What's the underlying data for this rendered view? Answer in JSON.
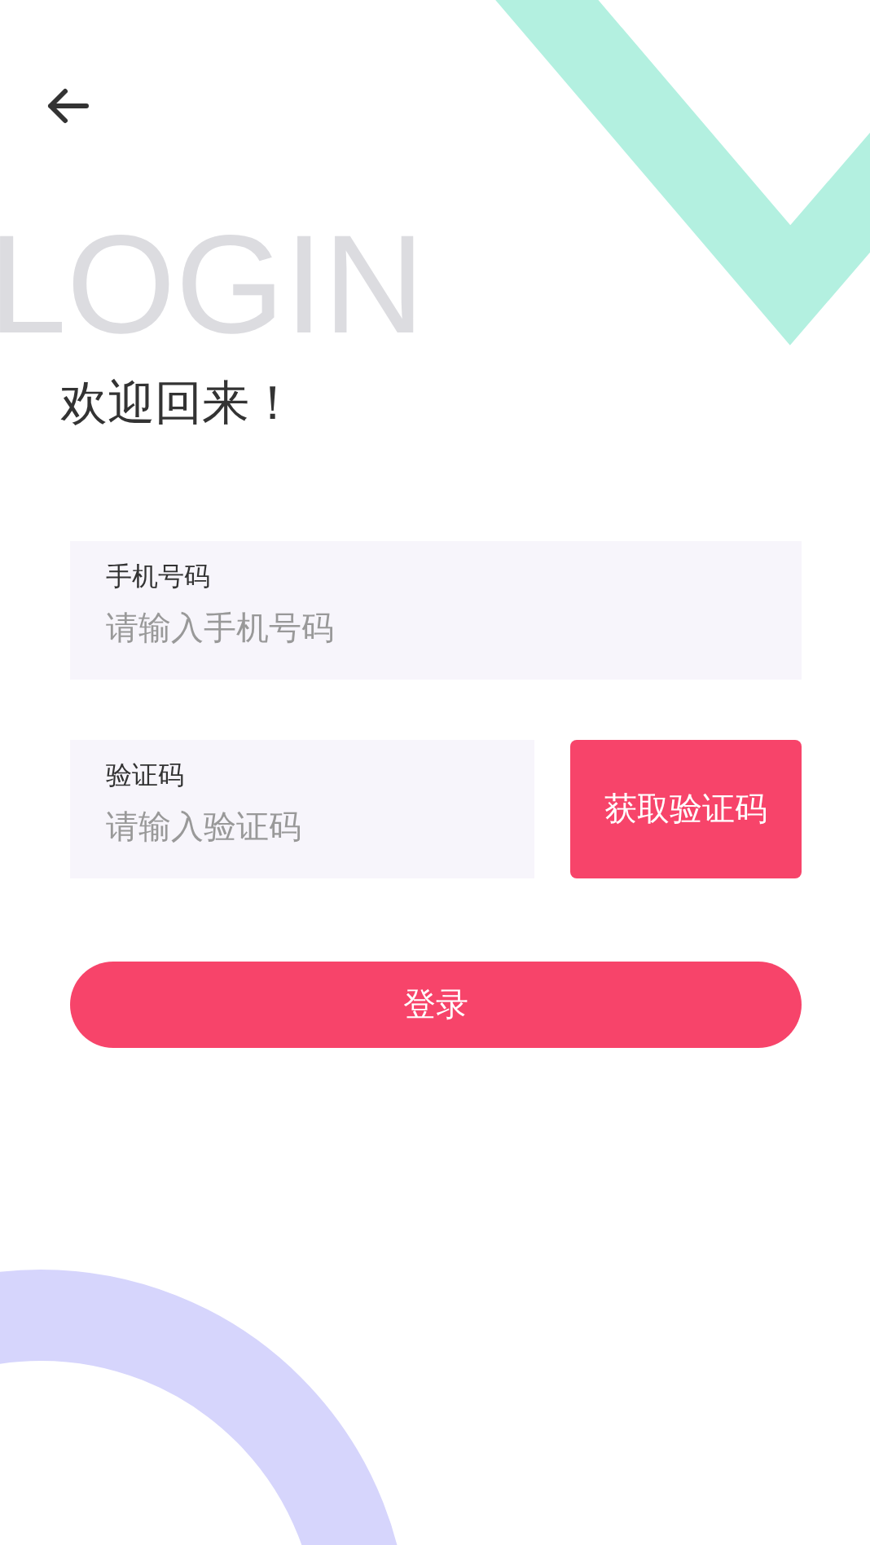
{
  "background_text": "LOGIN",
  "title": "欢迎回来！",
  "fields": [
    {
      "label": "手机号码",
      "placeholder": "请输入手机号码"
    },
    {
      "label": "验证码",
      "placeholder": "请输入验证码"
    }
  ],
  "code_button": "获取验证码",
  "login_button": "登录"
}
